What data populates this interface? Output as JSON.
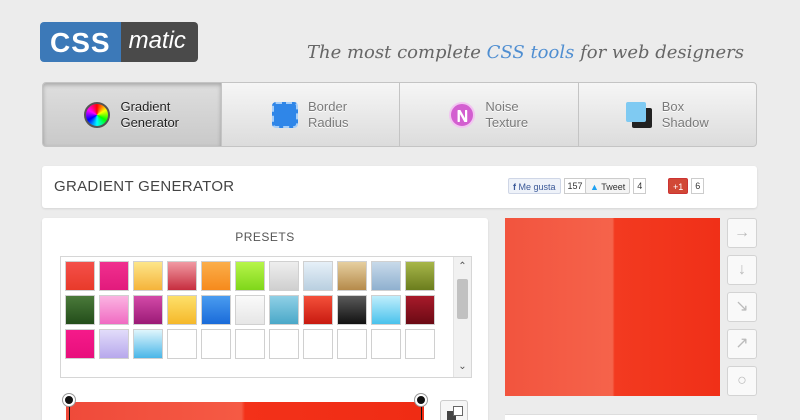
{
  "header": {
    "logo_css": "CSS",
    "logo_matic": "matic",
    "tagline_prefix": "The most complete ",
    "tagline_highlight": "CSS tools",
    "tagline_suffix": " for web designers"
  },
  "tabs": [
    {
      "line1": "Gradient",
      "line2": "Generator",
      "icon": "color-wheel-icon",
      "active": true
    },
    {
      "line1": "Border",
      "line2": "Radius",
      "icon": "border-radius-icon",
      "active": false
    },
    {
      "line1": "Noise",
      "line2": "Texture",
      "icon": "noise-icon",
      "active": false
    },
    {
      "line1": "Box",
      "line2": "Shadow",
      "icon": "box-shadow-icon",
      "active": false
    }
  ],
  "title_bar": {
    "title": "GRADIENT GENERATOR",
    "facebook_label": "Me gusta",
    "facebook_count": "157",
    "tweet_label": "Tweet",
    "tweet_count": "4",
    "gplus_label": "+1",
    "gplus_count": "6"
  },
  "presets": {
    "title": "PRESETS",
    "swatches": [
      [
        "#f4504a",
        "#e83a2a"
      ],
      [
        "#f0308f",
        "#e21a7c"
      ],
      [
        "#fde68a",
        "#f5b33a"
      ],
      [
        "#f19aa3",
        "#c62d3e"
      ],
      [
        "#fbae4a",
        "#f68a1c"
      ],
      [
        "#b7f54a",
        "#7fd61a"
      ],
      [
        "#eeeeee",
        "#cfcfcf"
      ],
      [
        "#e6f0f8",
        "#b9cfe0"
      ],
      [
        "#e6cfa0",
        "#b58a4a"
      ],
      [
        "#c8daea",
        "#8fb0cf"
      ],
      [
        "#a7b64a",
        "#6b7d1d"
      ],
      [
        "#4a7a3a",
        "#234d1a"
      ],
      [
        "#fbb4e2",
        "#f06bc2"
      ],
      [
        "#d34aa8",
        "#9b1a76"
      ],
      [
        "#fde06a",
        "#f5b82a"
      ],
      [
        "#4a9cf0",
        "#1a6bd9"
      ],
      [
        "#fafafa",
        "#e6e6e6"
      ],
      [
        "#8fd0e6",
        "#4aa8c8"
      ],
      [
        "#f4503a",
        "#c81a10"
      ],
      [
        "#5a5a5a",
        "#111111"
      ],
      [
        "#bfeefc",
        "#4ac2ec"
      ],
      [
        "#a81a2a",
        "#6b0a14"
      ],
      [
        "#f51a8a",
        "#e80f7c"
      ],
      [
        "#e2dcfa",
        "#b7a8ec"
      ],
      [
        "#dff5fc",
        "#4ab6e8"
      ],
      [
        "#ffffff",
        "#ffffff"
      ],
      [
        "#ffffff",
        "#ffffff"
      ],
      [
        "#ffffff",
        "#ffffff"
      ],
      [
        "#ffffff",
        "#ffffff"
      ],
      [
        "#ffffff",
        "#ffffff"
      ],
      [
        "#ffffff",
        "#ffffff"
      ],
      [
        "#ffffff",
        "#ffffff"
      ],
      [
        "#ffffff",
        "#ffffff"
      ]
    ]
  },
  "colors": {
    "accent": "#4f8ed1",
    "logo_blue": "#3c79b8",
    "logo_dark": "#4a4a4a",
    "gradient_start": "#f2543e",
    "gradient_end": "#f03018"
  }
}
